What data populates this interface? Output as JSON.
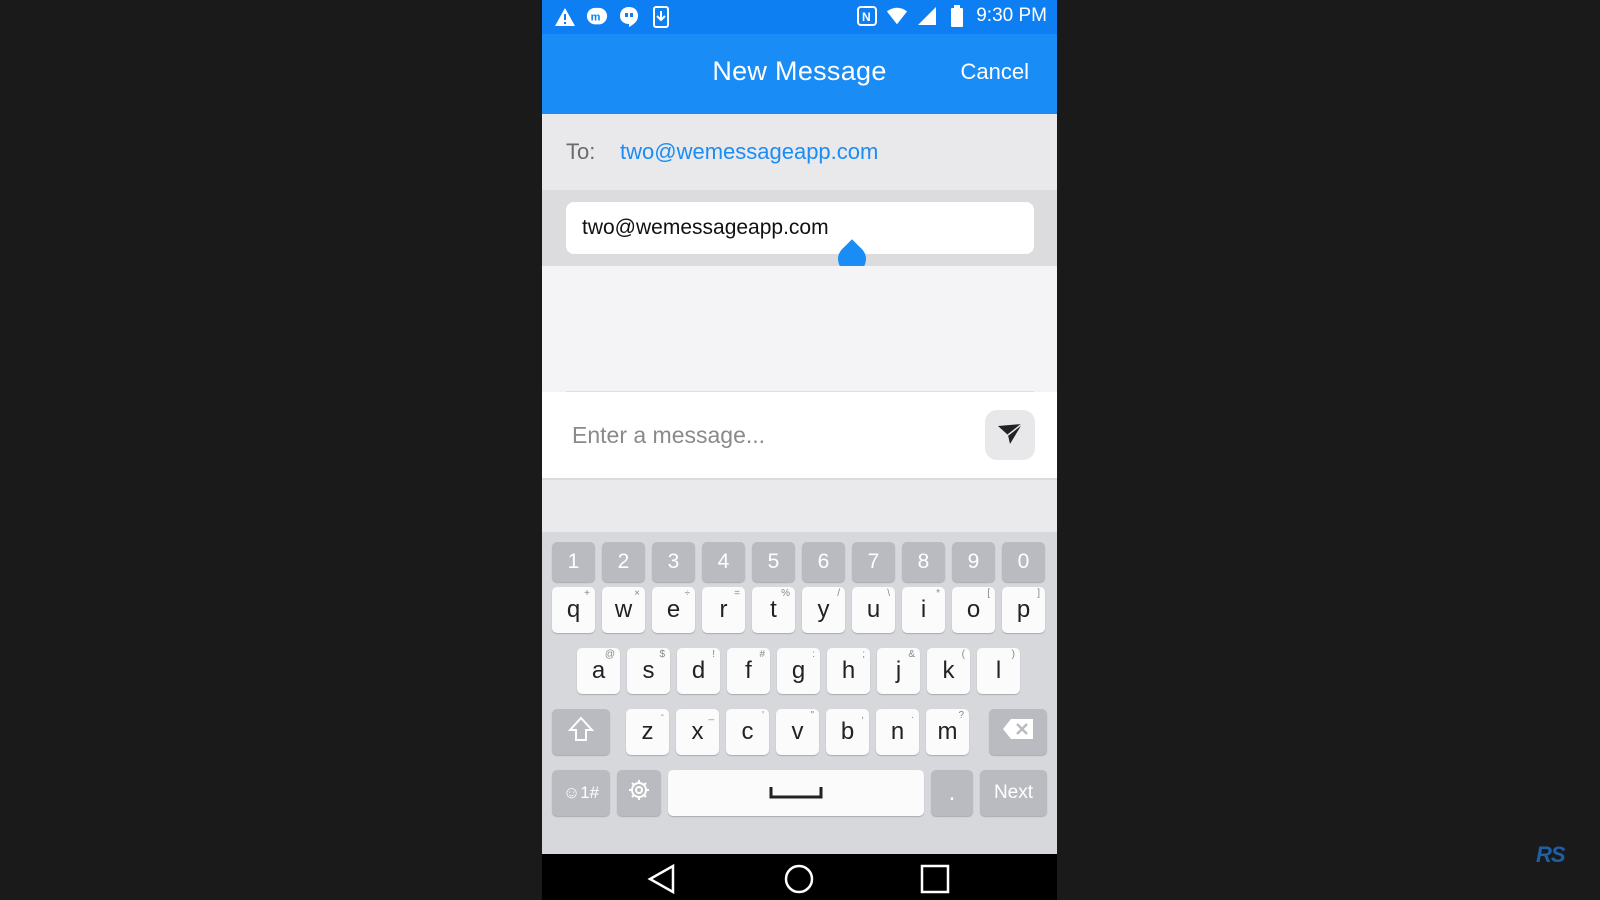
{
  "status_bar": {
    "time": "9:30 PM",
    "left_icons": [
      "warning-icon",
      "messenger-icon",
      "hangouts-icon",
      "download-icon"
    ],
    "right_icons": [
      "nfc-icon",
      "wifi-icon",
      "signal-icon",
      "battery-icon"
    ]
  },
  "header": {
    "title": "New Message",
    "cancel_label": "Cancel"
  },
  "to_row": {
    "label": "To:",
    "value": "two@wemessageapp.com"
  },
  "recipient_field": {
    "value": "two@wemessageapp.com"
  },
  "compose": {
    "placeholder": "Enter a message..."
  },
  "keyboard": {
    "number_row": [
      "1",
      "2",
      "3",
      "4",
      "5",
      "6",
      "7",
      "8",
      "9",
      "0"
    ],
    "row1": [
      {
        "k": "q",
        "alt": "+"
      },
      {
        "k": "w",
        "alt": "×"
      },
      {
        "k": "e",
        "alt": "÷"
      },
      {
        "k": "r",
        "alt": "="
      },
      {
        "k": "t",
        "alt": "%"
      },
      {
        "k": "y",
        "alt": "/"
      },
      {
        "k": "u",
        "alt": "\\"
      },
      {
        "k": "i",
        "alt": "*"
      },
      {
        "k": "o",
        "alt": "["
      },
      {
        "k": "p",
        "alt": "]"
      }
    ],
    "row2": [
      {
        "k": "a",
        "alt": "@"
      },
      {
        "k": "s",
        "alt": "$"
      },
      {
        "k": "d",
        "alt": "!"
      },
      {
        "k": "f",
        "alt": "#"
      },
      {
        "k": "g",
        "alt": ":"
      },
      {
        "k": "h",
        "alt": ";"
      },
      {
        "k": "j",
        "alt": "&"
      },
      {
        "k": "k",
        "alt": "("
      },
      {
        "k": "l",
        "alt": ")"
      }
    ],
    "row3": [
      {
        "k": "z",
        "alt": "-"
      },
      {
        "k": "x",
        "alt": "_"
      },
      {
        "k": "c",
        "alt": "'"
      },
      {
        "k": "v",
        "alt": "\""
      },
      {
        "k": "b",
        "alt": ","
      },
      {
        "k": "n",
        "alt": "."
      },
      {
        "k": "m",
        "alt": "?"
      }
    ],
    "symbols_label": "☺1#",
    "period_label": ".",
    "next_label": "Next"
  },
  "watermark": "RS",
  "colors": {
    "accent": "#1a8cf6",
    "status_bar": "#0d7ff3",
    "background": "#1a1a1a"
  }
}
